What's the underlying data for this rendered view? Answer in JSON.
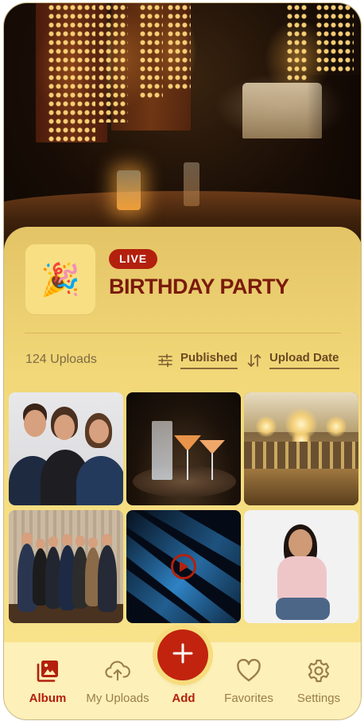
{
  "event": {
    "status_badge": "LIVE",
    "title": "BIRTHDAY PARTY",
    "icon": "party-popper-icon",
    "icon_glyph": "🎉"
  },
  "toolbar": {
    "uploads_count": "124 Uploads",
    "filter_label": "Published",
    "sort_label": "Upload Date"
  },
  "gallery": {
    "items": [
      {
        "name": "group-photo-three-people",
        "type": "photo"
      },
      {
        "name": "cocktails-on-tray",
        "type": "photo"
      },
      {
        "name": "ballroom-chandeliers",
        "type": "photo"
      },
      {
        "name": "group-photo-team",
        "type": "photo"
      },
      {
        "name": "stage-lights-video",
        "type": "video"
      },
      {
        "name": "smiling-woman-portrait",
        "type": "photo"
      }
    ]
  },
  "nav": {
    "items": [
      {
        "label": "Album",
        "icon": "album-icon",
        "active": true
      },
      {
        "label": "My Uploads",
        "icon": "cloud-upload-icon",
        "active": false
      },
      {
        "label": "Add",
        "icon": "plus-icon",
        "active": false
      },
      {
        "label": "Favorites",
        "icon": "heart-icon",
        "active": false
      },
      {
        "label": "Settings",
        "icon": "gear-icon",
        "active": false
      }
    ]
  },
  "colors": {
    "accent": "#b3200e",
    "title": "#7a1a0c",
    "card_bg": "#f2d878",
    "nav_bg": "#fdf0b8"
  }
}
